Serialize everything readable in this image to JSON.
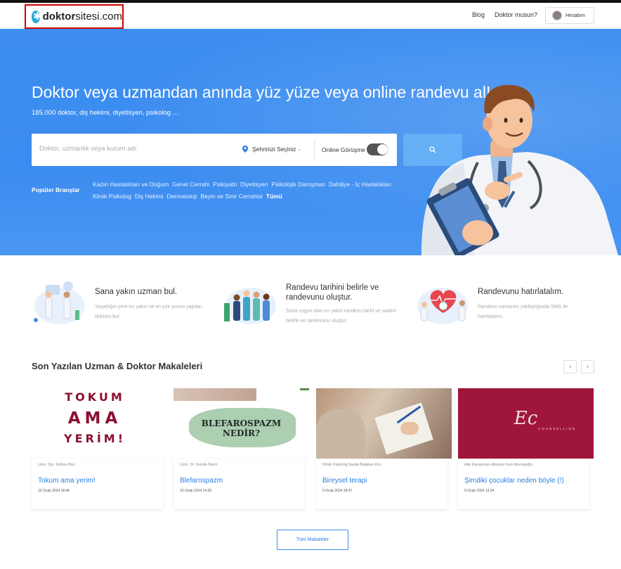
{
  "header": {
    "logo_bold": "doktor",
    "logo_rest": "sitesi.com",
    "nav": {
      "blog": "Blog",
      "doctor": "Doktor musun?",
      "account": "Hesabım"
    }
  },
  "hero": {
    "title": "Doktor veya uzmandan anında yüz yüze veya online randevu al!",
    "subtitle": "185.000 doktor, diş hekimi, diyetisyen, psikolog ...",
    "search": {
      "placeholder": "Doktor, uzmanlık veya kurum adı",
      "city": "Şehrinizi Seçiniz",
      "online_label": "Online Görüşme",
      "online_enabled": false
    },
    "popular_label": "Popüler Branşlar",
    "popular": [
      "Kadın Hastalıkları ve Doğum",
      "Genel Cerrahi",
      "Psikiyatri",
      "Diyetisyen",
      "Psikolojik Danışman",
      "Dahiliye - İç Hastalıkları",
      "Klinik Psikolog",
      "Diş Hekimi",
      "Dermatoloji",
      "Beyin ve Sinir Cerrahisi"
    ],
    "popular_all": "Tümü"
  },
  "features": [
    {
      "title": "Sana yakın uzman bul.",
      "desc": "Yaşadığın yere en yakın ve en çok yorum yapılan doktoru bul."
    },
    {
      "title": "Randevu tarihini belirle ve randevunu oluştur.",
      "desc": "Sana uygun olan en yakın randevu tarihi ve saatini belirle ve randevunu oluştur."
    },
    {
      "title": "Randevunu hatırlatalım.",
      "desc": "Randevu zamanını yaklaştığında SMS ile hatırlatalım."
    }
  ],
  "articles_section": {
    "title": "Son Yazılan Uzman & Doktor Makaleleri",
    "prev": "‹",
    "next": "›",
    "all_button": "Tüm Makaleler",
    "cards": [
      {
        "author": "Uzm. Dyt. Göksu Boz",
        "title": "Tokum ama yerim!",
        "date": "10 Ocak 2024 18:46",
        "img_lines": [
          "TOKUM",
          "AMA",
          "YERİM!"
        ]
      },
      {
        "author": "Uzm. Dr. Gözde Nezir",
        "title": "Blefarospazm",
        "date": "10 Ocak 2024 14:35",
        "img_lines": [
          "BLEFAROSPAZM",
          "NEDİR?"
        ]
      },
      {
        "author": "Klinik Psikolog İlayda Balaban Kul",
        "title": "Bireysel terapi",
        "date": "9 Ocak 2024 18:07",
        "img_lines": []
      },
      {
        "author": "Aile Danışmanı Afranur Kısa Memişoğlu",
        "title": "Şimdiki çocuklar neden böyle (!)",
        "date": "9 Ocak 2024 13:34",
        "img_lines": [
          "Ec",
          "COUNSELLING"
        ]
      }
    ]
  },
  "colors": {
    "primary": "#3b8cf0",
    "link": "#2a7de1",
    "logo_border": "#d40000"
  }
}
